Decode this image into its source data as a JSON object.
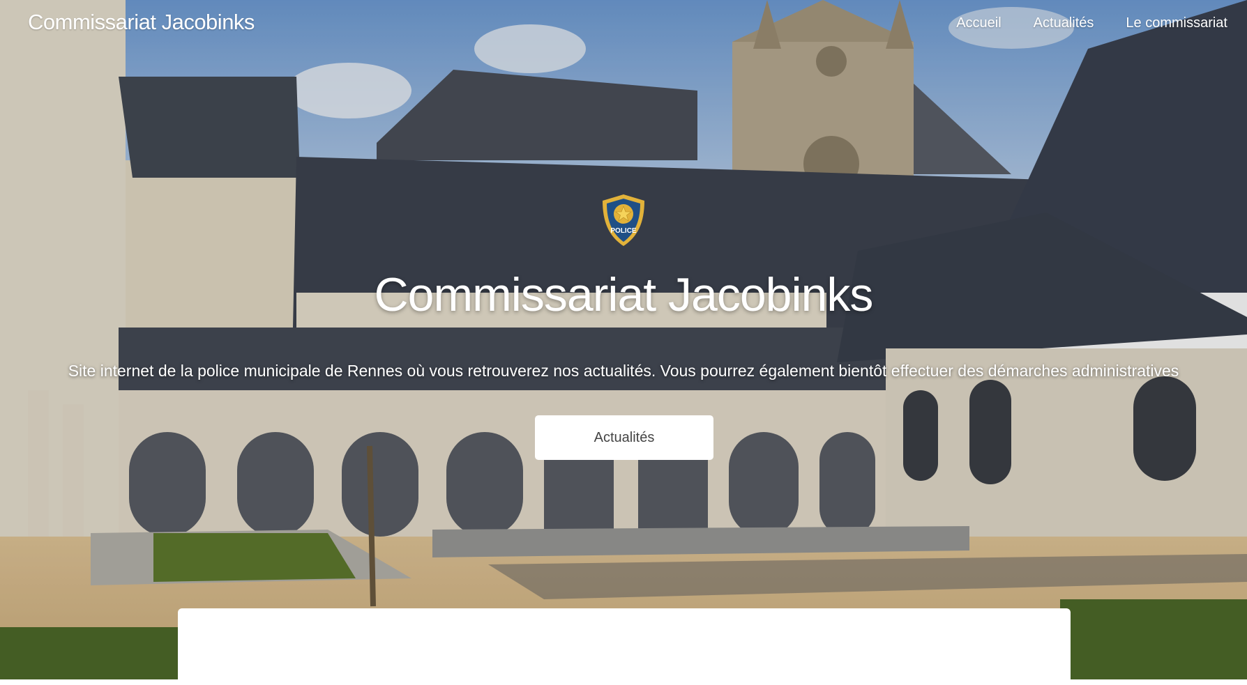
{
  "brand": {
    "name": "Commissariat Jacobinks"
  },
  "nav": {
    "items": [
      "Accueil",
      "Actualités",
      "Le commissariat"
    ]
  },
  "hero": {
    "badge_text": "POLICE",
    "title": "Commissariat Jacobinks",
    "subtitle": "Site internet de la police municipale de Rennes où vous retrouverez nos actualités. Vous pourrez également bientôt effectuer des démarches administratives",
    "cta_label": "Actualités"
  },
  "colors": {
    "sky": "#8fb2d9",
    "roof": "#3d4350",
    "stone": "#e8e1d2",
    "gravel": "#d9bb8a",
    "badge_blue": "#1f4f86",
    "badge_gold": "#e2b23a"
  },
  "icons": {
    "badge": "police-badge-icon"
  }
}
